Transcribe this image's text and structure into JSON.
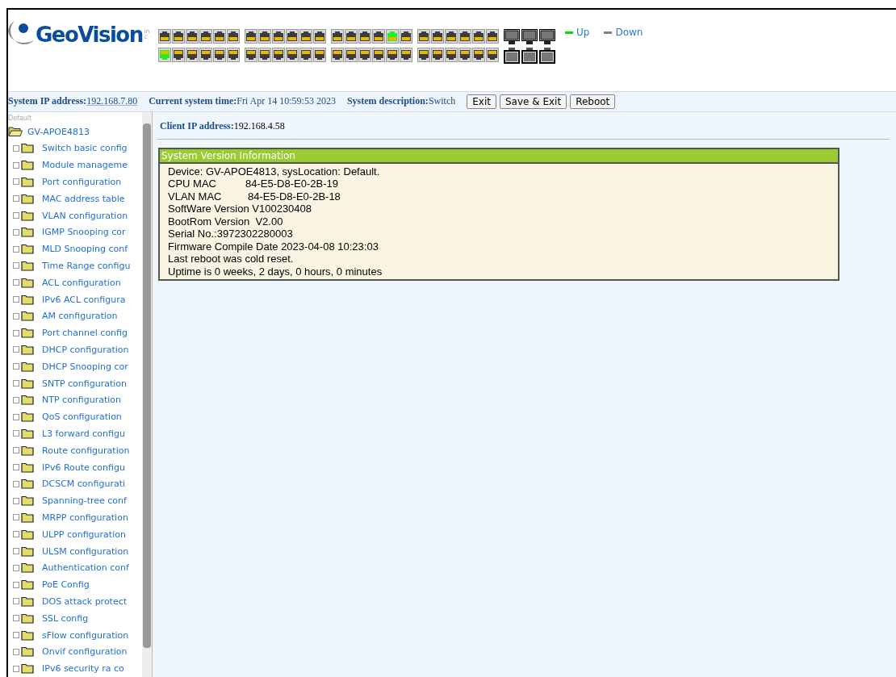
{
  "header": {
    "logo": "GeoVision",
    "logo_suffix": "inc",
    "legend": [
      {
        "label": "Up",
        "color": "#00dd00"
      },
      {
        "label": "Down",
        "color": "#808080"
      }
    ]
  },
  "ports": {
    "top": [
      {
        "up": false
      },
      {
        "up": false
      },
      {
        "up": false
      },
      {
        "up": false
      },
      {
        "up": false
      },
      {
        "up": false
      },
      {
        "up": false
      },
      {
        "up": false
      },
      {
        "up": false
      },
      {
        "up": false
      },
      {
        "up": false
      },
      {
        "up": false
      },
      {
        "up": false
      },
      {
        "up": false
      },
      {
        "up": false
      },
      {
        "up": false
      },
      {
        "up": true
      },
      {
        "up": false
      },
      {
        "up": false
      },
      {
        "up": false
      },
      {
        "up": false
      },
      {
        "up": false
      },
      {
        "up": false
      },
      {
        "up": false
      }
    ],
    "bottom": [
      {
        "up": true
      },
      {
        "up": false
      },
      {
        "up": false
      },
      {
        "up": false
      },
      {
        "up": false
      },
      {
        "up": false
      },
      {
        "up": false
      },
      {
        "up": false
      },
      {
        "up": false
      },
      {
        "up": false
      },
      {
        "up": false
      },
      {
        "up": false
      },
      {
        "up": false
      },
      {
        "up": false
      },
      {
        "up": false
      },
      {
        "up": false
      },
      {
        "up": false
      },
      {
        "up": false
      },
      {
        "up": false
      },
      {
        "up": false
      },
      {
        "up": false
      },
      {
        "up": false
      },
      {
        "up": false
      },
      {
        "up": false
      }
    ]
  },
  "info_bar": {
    "items": [
      {
        "label": "System IP address:",
        "value": "192.168.7.80"
      },
      {
        "label": "Current system time:",
        "value": "Fri Apr 14 10:59:53 2023"
      },
      {
        "label": "System description:",
        "value": "Switch"
      }
    ],
    "buttons": [
      "Exit",
      "Save & Exit",
      "Reboot"
    ]
  },
  "sidebar": {
    "caption": "Default",
    "root": {
      "label": "GV-APOE4813",
      "expanded": true,
      "children": [
        {
          "label": "Switch basic config"
        },
        {
          "label": "Module manageme"
        },
        {
          "label": "Port configuration"
        },
        {
          "label": "MAC address table"
        },
        {
          "label": "VLAN configuration"
        },
        {
          "label": "IGMP Snooping cor"
        },
        {
          "label": "MLD Snooping conf"
        },
        {
          "label": "Time Range configu"
        },
        {
          "label": "ACL configuration"
        },
        {
          "label": "IPv6 ACL configura"
        },
        {
          "label": "AM configuration"
        },
        {
          "label": "Port channel config"
        },
        {
          "label": "DHCP configuration"
        },
        {
          "label": "DHCP Snooping cor"
        },
        {
          "label": "SNTP configuration"
        },
        {
          "label": "NTP configuration"
        },
        {
          "label": "QoS configuration"
        },
        {
          "label": "L3 forward configu"
        },
        {
          "label": "Route configuration"
        },
        {
          "label": "IPv6 Route configu"
        },
        {
          "label": "DCSCM configurati"
        },
        {
          "label": "Spanning-tree conf"
        },
        {
          "label": "MRPP configuration"
        },
        {
          "label": "ULPP configuration"
        },
        {
          "label": "ULSM configuration"
        },
        {
          "label": "Authentication conf"
        },
        {
          "label": "PoE Config"
        },
        {
          "label": "DOS attack protect"
        },
        {
          "label": "SSL config"
        },
        {
          "label": "sFlow configuration"
        },
        {
          "label": "Onvif configuration"
        },
        {
          "label": "IPv6 security ra co"
        }
      ]
    }
  },
  "content": {
    "client_ip_label": "Client IP address:",
    "client_ip": "192.168.4.58",
    "panel": {
      "title": "System Version Information",
      "lines": [
        "Device: GV-APOE4813, sysLocation: Default.",
        "CPU MAC          84-E5-D8-E0-2B-19",
        "VLAN MAC         84-E5-D8-E0-2B-18",
        "SoftWare Version V100230408",
        "BootRom Version  V2.00",
        "Serial No.:3972302280003",
        "Firmware Compile Date 2023-04-08 10:23:03",
        "Last reboot was cold reset.",
        "Uptime is 0 weeks, 2 days, 0 hours, 0 minutes"
      ]
    }
  }
}
